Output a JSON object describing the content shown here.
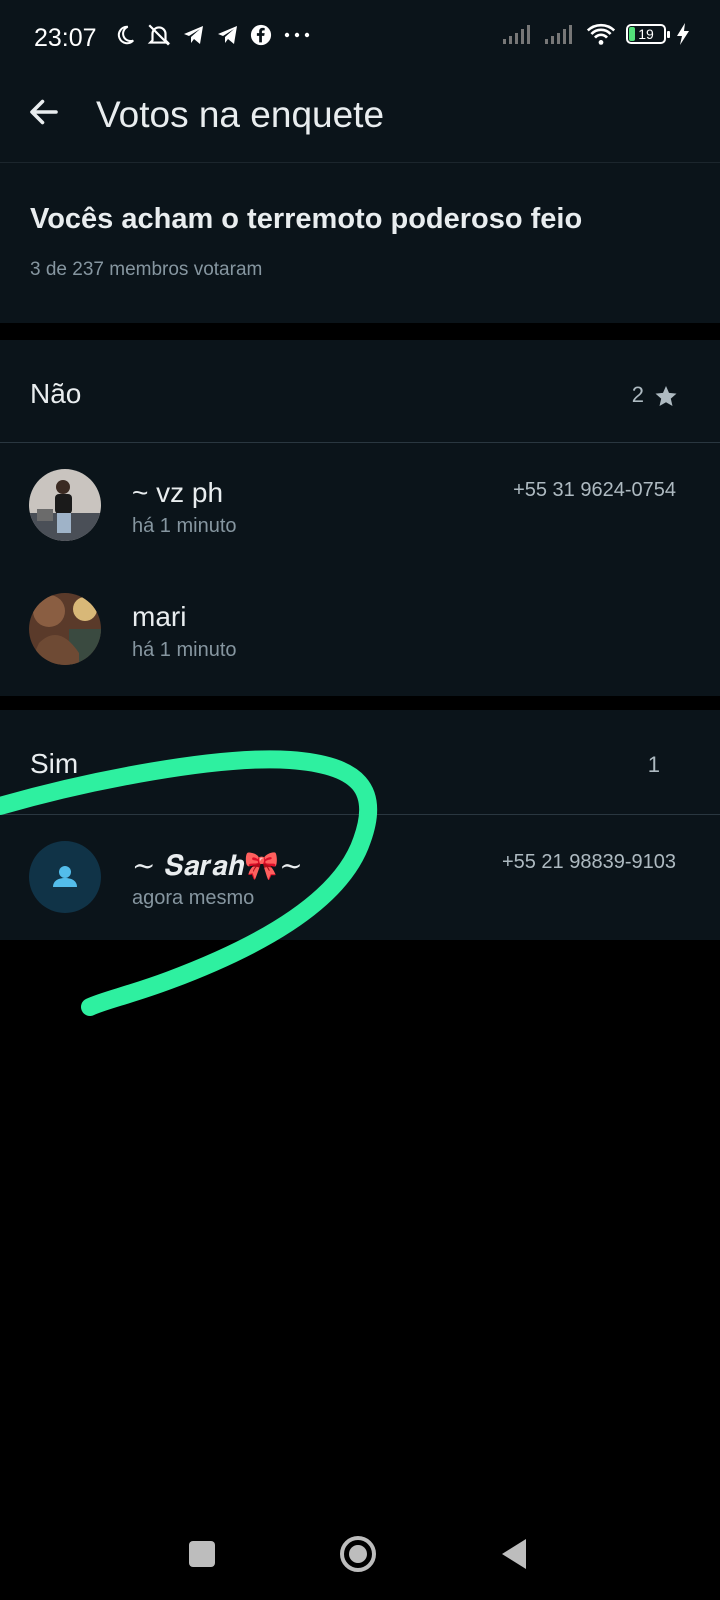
{
  "status_bar": {
    "time": "23:07",
    "battery": "19",
    "icons_left": [
      "moon-icon",
      "muted-bell-icon",
      "telegram-icon",
      "telegram-icon",
      "facebook-icon",
      "more-dots-icon"
    ],
    "icons_right": [
      "signal-icon",
      "signal-icon",
      "wifi-icon",
      "battery-icon",
      "charging-icon"
    ]
  },
  "app_bar": {
    "title": "Votos na enquete"
  },
  "poll": {
    "question": "Vocês acham o terremoto poderoso feio",
    "summary": "3 de 237 membros votaram"
  },
  "options": [
    {
      "label": "Não",
      "count": "2",
      "starred": true,
      "voters": [
        {
          "name": "~ vz ph",
          "time": "há 1 minuto",
          "phone": "+55 31 9624-0754",
          "avatar": "photo"
        },
        {
          "name": "mari",
          "time": "há 1 minuto",
          "phone": "",
          "avatar": "photo"
        }
      ]
    },
    {
      "label": "Sim",
      "count": "1",
      "starred": false,
      "voters": [
        {
          "name": "~ 𝑺𝒂𝒓𝒂𝒉🎀~",
          "time": "agora mesmo",
          "phone": "+55 21 98839-9103",
          "avatar": "default-person-icon"
        }
      ]
    }
  ],
  "colors": {
    "background": "#0b141a",
    "text_primary": "#e9edef",
    "text_secondary": "#8696a0",
    "scribble": "#2ef0a0"
  }
}
